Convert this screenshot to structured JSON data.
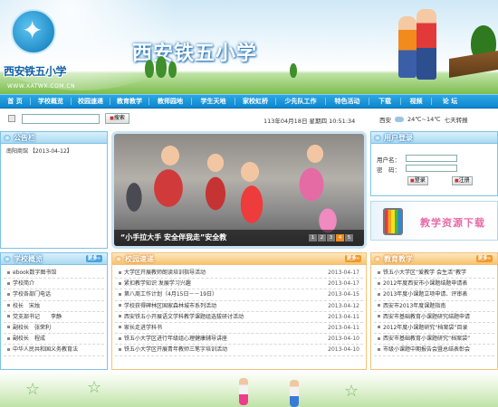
{
  "header": {
    "logo_text": "西安铁五小学",
    "site_url": "WWW.XATWX.COM.CN",
    "school_title": "西安铁五小学"
  },
  "nav": {
    "items": [
      "首 页",
      "学校概览",
      "校园速递",
      "教育教学",
      "教师园地",
      "学生天地",
      "家校虹桥",
      "少先队工作",
      "特色活动",
      "下载",
      "视频",
      "论 坛"
    ]
  },
  "toolbar": {
    "search_placeholder": "",
    "search_label": "搜索",
    "datetime": "113年04月18日 星期四 10:51:34",
    "weather_city": "西安",
    "weather_temp": "24℃~14℃",
    "weather_more": "七天转报"
  },
  "notice": {
    "title": "公告栏",
    "text": "南阳商馆 【2013-04-12】"
  },
  "slideshow": {
    "caption": "“小手拉大手 安全伴我走”安全教",
    "pages": [
      "1",
      "2",
      "3",
      "4",
      "5"
    ],
    "active_page": "4"
  },
  "login": {
    "title": "用户登录",
    "username_label": "用户名：",
    "password_label": "密　码：",
    "login_button": "登录",
    "register_button": "注册"
  },
  "resource": {
    "text": "教学资源下载"
  },
  "overview": {
    "title": "学校概览",
    "more": "更多",
    "items": [
      "ebook数字图书馆",
      "学校简介",
      "学校各部门电话",
      "校长　宋烛",
      "党支部书记　　李静",
      "副校长　张荣利",
      "副校长　程成",
      "中华人民共和国义务教育法"
    ]
  },
  "news": {
    "title": "校园速递",
    "more": "更多",
    "items": [
      {
        "title": "大学区开展教师朗读培训指导活动",
        "date": "2013-04-17"
      },
      {
        "title": "紧扣教学知识 发展学习兴趣",
        "date": "2013-04-17"
      },
      {
        "title": "第八周工作计划（4月15日－－19日）",
        "date": "2013-04-15"
      },
      {
        "title": "学校获得碑林区国家森林城市系列活动",
        "date": "2013-04-12"
      },
      {
        "title": "西安铁五小开展语文学科教学课题组选拔研讨活动",
        "date": "2013-04-11"
      },
      {
        "title": "家长走进学科书",
        "date": "2013-04-11"
      },
      {
        "title": "铁五小大学区进行年级组心理健康辅导讲座",
        "date": "2013-04-10"
      },
      {
        "title": "铁五小大学区开展青年教师三笔字培训活动",
        "date": "2013-04-10"
      }
    ]
  },
  "teaching": {
    "title": "教育教学",
    "more": "更多",
    "items": [
      "铁五小大学区“爱教学 会生活”教学",
      "2012年度西安市小课题结题申请表",
      "2013年度小课题立项申请、评审表",
      "西安市2013年度课题指南",
      "西安市基础教育小课题研究结题申请",
      "2012年度小课题研究“档案袋”目录",
      "西安市基础教育小课题研究“档案袋”",
      "市级小课题中期报告会暨总结表彰会"
    ]
  },
  "colors": {
    "nav_blue": "#0c86cf",
    "panel_border": "#7dc2e6",
    "news_orange": "#f19a2c"
  }
}
